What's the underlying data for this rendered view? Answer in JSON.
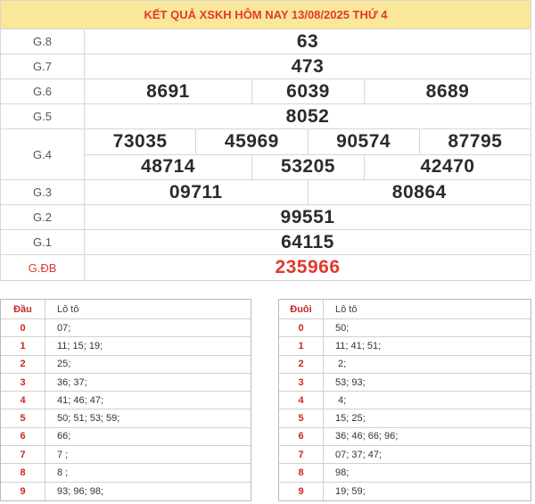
{
  "title": "KẾT QUẢ XSKH HÔM NAY 13/08/2025 THỨ 4",
  "prizes": [
    {
      "label": "G.8",
      "lines": [
        [
          "63"
        ]
      ]
    },
    {
      "label": "G.7",
      "lines": [
        [
          "473"
        ]
      ]
    },
    {
      "label": "G.6",
      "lines": [
        [
          "8691",
          "6039",
          "8689"
        ]
      ]
    },
    {
      "label": "G.5",
      "lines": [
        [
          "8052"
        ]
      ]
    },
    {
      "label": "G.4",
      "lines": [
        [
          "73035",
          "45969",
          "90574",
          "87795"
        ],
        [
          "48714",
          "53205",
          "42470"
        ]
      ]
    },
    {
      "label": "G.3",
      "lines": [
        [
          "09711",
          "80864"
        ]
      ]
    },
    {
      "label": "G.2",
      "lines": [
        [
          "99551"
        ]
      ]
    },
    {
      "label": "G.1",
      "lines": [
        [
          "64115"
        ]
      ]
    },
    {
      "label": "G.ĐB",
      "lines": [
        [
          "235966"
        ]
      ]
    }
  ],
  "loto_head": {
    "header": {
      "key": "Đầu",
      "value": "Lô tô"
    },
    "rows": [
      {
        "key": "0",
        "value": "07;"
      },
      {
        "key": "1",
        "value": "11; 15; 19;"
      },
      {
        "key": "2",
        "value": "25;"
      },
      {
        "key": "3",
        "value": "36; 37;"
      },
      {
        "key": "4",
        "value": "41; 46; 47;"
      },
      {
        "key": "5",
        "value": "50; 51; 53; 59;"
      },
      {
        "key": "6",
        "value": "66;"
      },
      {
        "key": "7",
        "value": "7 ;"
      },
      {
        "key": "8",
        "value": "8 ;"
      },
      {
        "key": "9",
        "value": "93; 96; 98;"
      }
    ]
  },
  "loto_tail": {
    "header": {
      "key": "Đuôi",
      "value": "Lô tô"
    },
    "rows": [
      {
        "key": "0",
        "value": "50;"
      },
      {
        "key": "1",
        "value": "11; 41; 51;"
      },
      {
        "key": "2",
        "value": " 2;"
      },
      {
        "key": "3",
        "value": "53; 93;"
      },
      {
        "key": "4",
        "value": " 4;"
      },
      {
        "key": "5",
        "value": "15; 25;"
      },
      {
        "key": "6",
        "value": "36; 46; 66; 96;"
      },
      {
        "key": "7",
        "value": "07; 37; 47;"
      },
      {
        "key": "8",
        "value": "98;"
      },
      {
        "key": "9",
        "value": "19; 59;"
      }
    ]
  },
  "colors": {
    "header_bg": "#fbe79a",
    "accent_red": "#e03a2e",
    "border": "#d6d6d6"
  }
}
